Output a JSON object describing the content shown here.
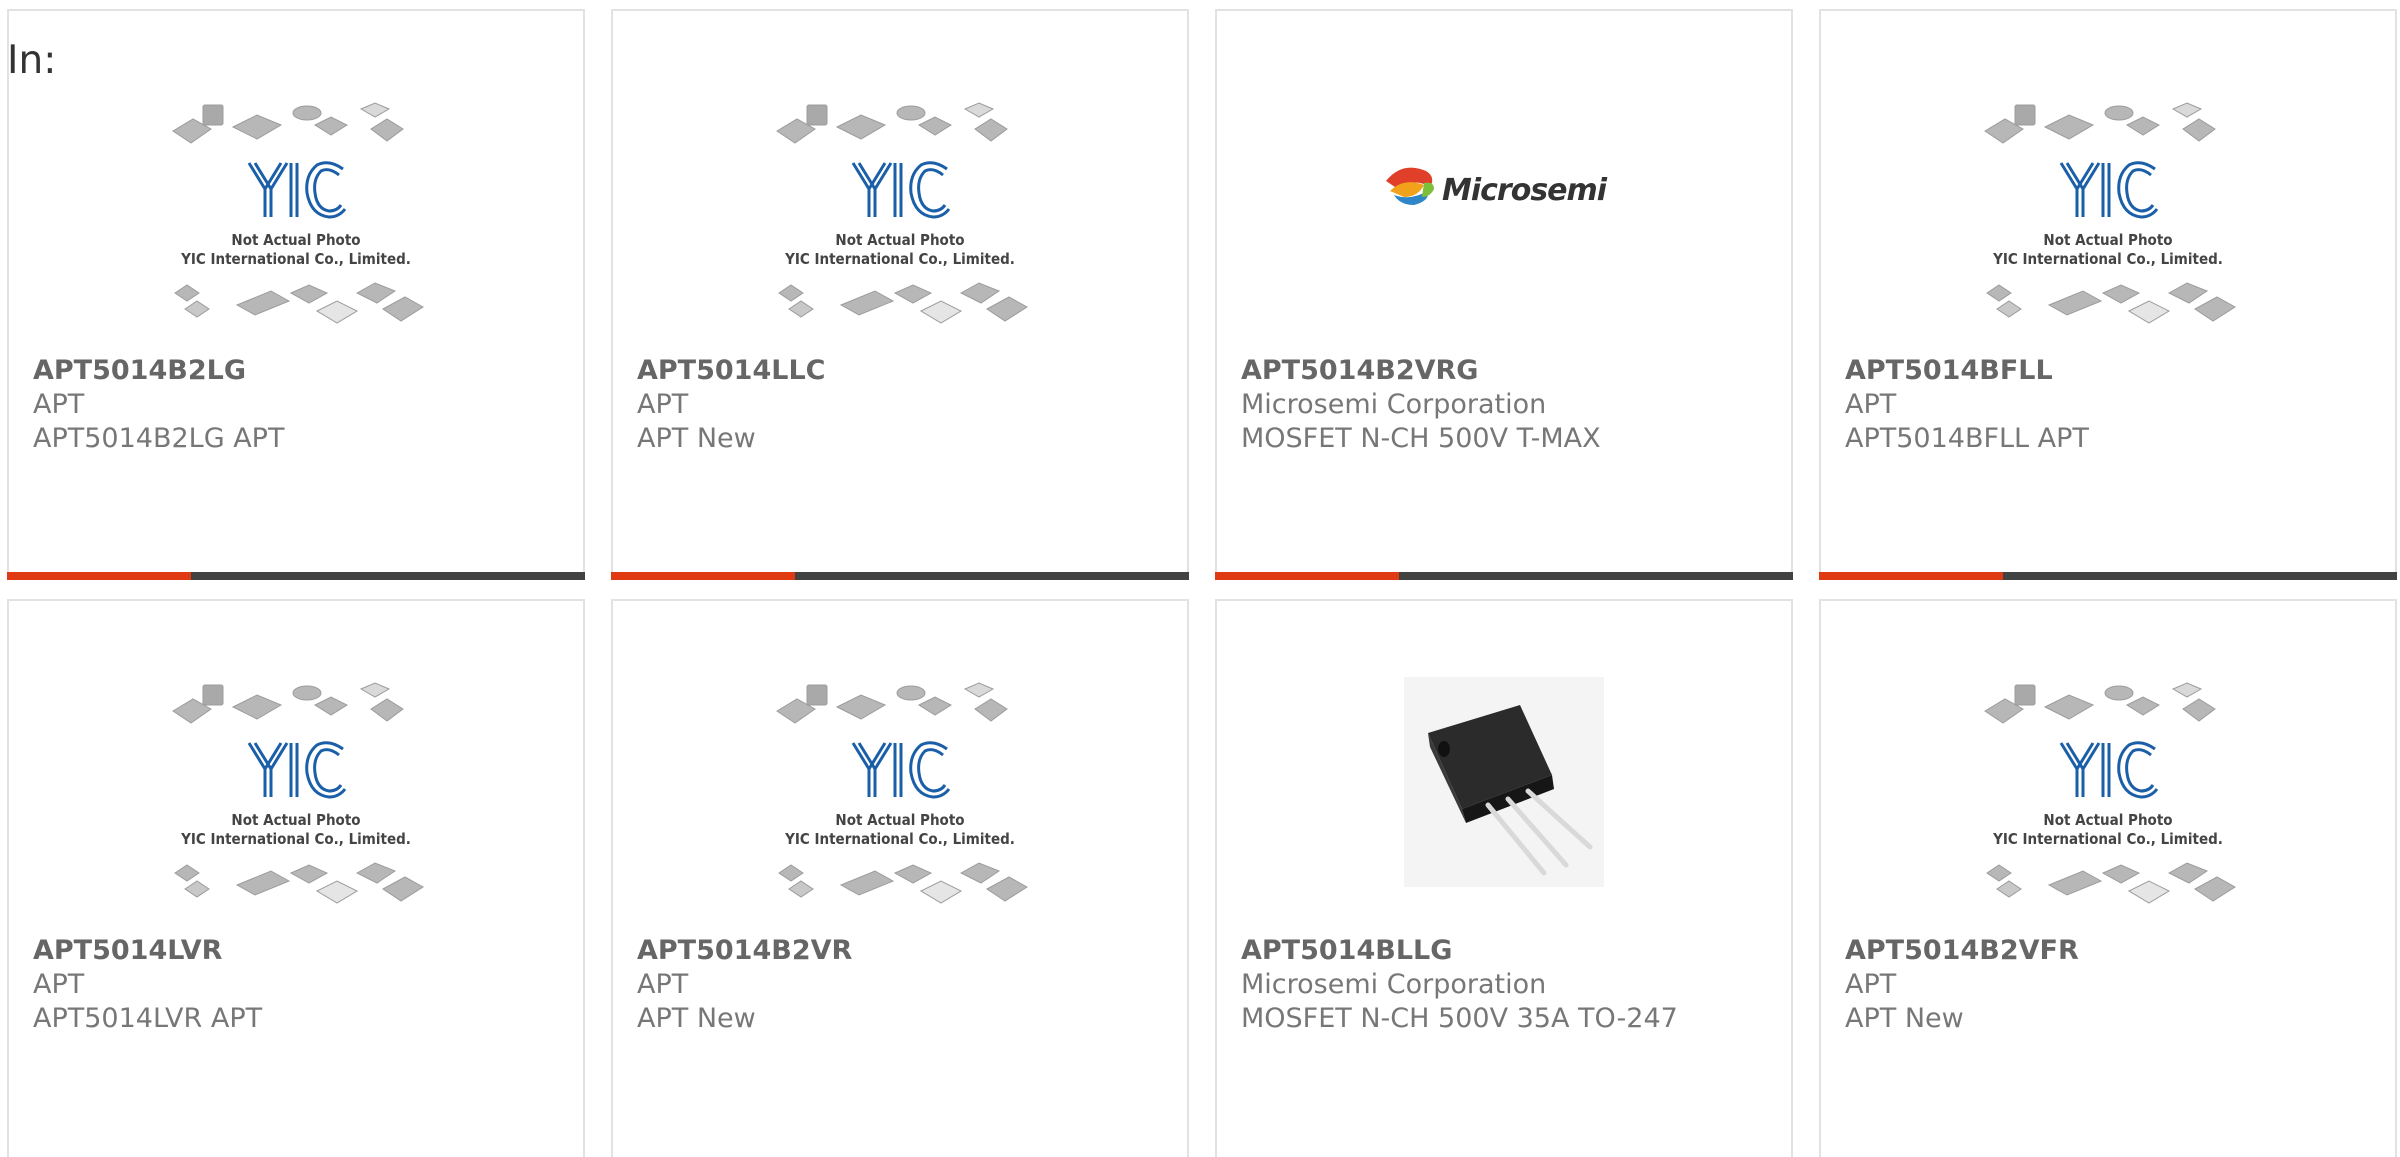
{
  "filter_label": "In:",
  "colors": {
    "accent": "#e03a12",
    "bar": "#424242",
    "border": "#e2e2e2",
    "part_number": "#666666",
    "meta": "#777777"
  },
  "cards": [
    {
      "part_number": "APT5014B2LG",
      "manufacturer": "APT",
      "description": "APT5014B2LG APT",
      "image": "yic-placeholder",
      "placeholder_line1": "Not Actual Photo",
      "placeholder_line2": "YIC International Co., Limited.",
      "logo_text": "YIC"
    },
    {
      "part_number": "APT5014LLC",
      "manufacturer": "APT",
      "description": "APT New",
      "image": "yic-placeholder",
      "placeholder_line1": "Not Actual Photo",
      "placeholder_line2": "YIC International Co., Limited.",
      "logo_text": "YIC"
    },
    {
      "part_number": "APT5014B2VRG",
      "manufacturer": "Microsemi Corporation",
      "description": "MOSFET N-CH 500V T-MAX",
      "image": "microsemi-logo",
      "logo_text": "Microsemi"
    },
    {
      "part_number": "APT5014BFLL",
      "manufacturer": "APT",
      "description": "APT5014BFLL APT",
      "image": "yic-placeholder",
      "placeholder_line1": "Not Actual Photo",
      "placeholder_line2": "YIC International Co., Limited.",
      "logo_text": "YIC"
    },
    {
      "part_number": "APT5014LVR",
      "manufacturer": "APT",
      "description": "APT5014LVR APT",
      "image": "yic-placeholder",
      "placeholder_line1": "Not Actual Photo",
      "placeholder_line2": "YIC International Co., Limited.",
      "logo_text": "YIC"
    },
    {
      "part_number": "APT5014B2VR",
      "manufacturer": "APT",
      "description": "APT New",
      "image": "yic-placeholder",
      "placeholder_line1": "Not Actual Photo",
      "placeholder_line2": "YIC International Co., Limited.",
      "logo_text": "YIC"
    },
    {
      "part_number": "APT5014BLLG",
      "manufacturer": "Microsemi Corporation",
      "description": "MOSFET N-CH 500V 35A TO-247",
      "image": "to247-photo"
    },
    {
      "part_number": "APT5014B2VFR",
      "manufacturer": "APT",
      "description": "APT New",
      "image": "yic-placeholder",
      "placeholder_line1": "Not Actual Photo",
      "placeholder_line2": "YIC International Co., Limited.",
      "logo_text": "YIC"
    }
  ]
}
